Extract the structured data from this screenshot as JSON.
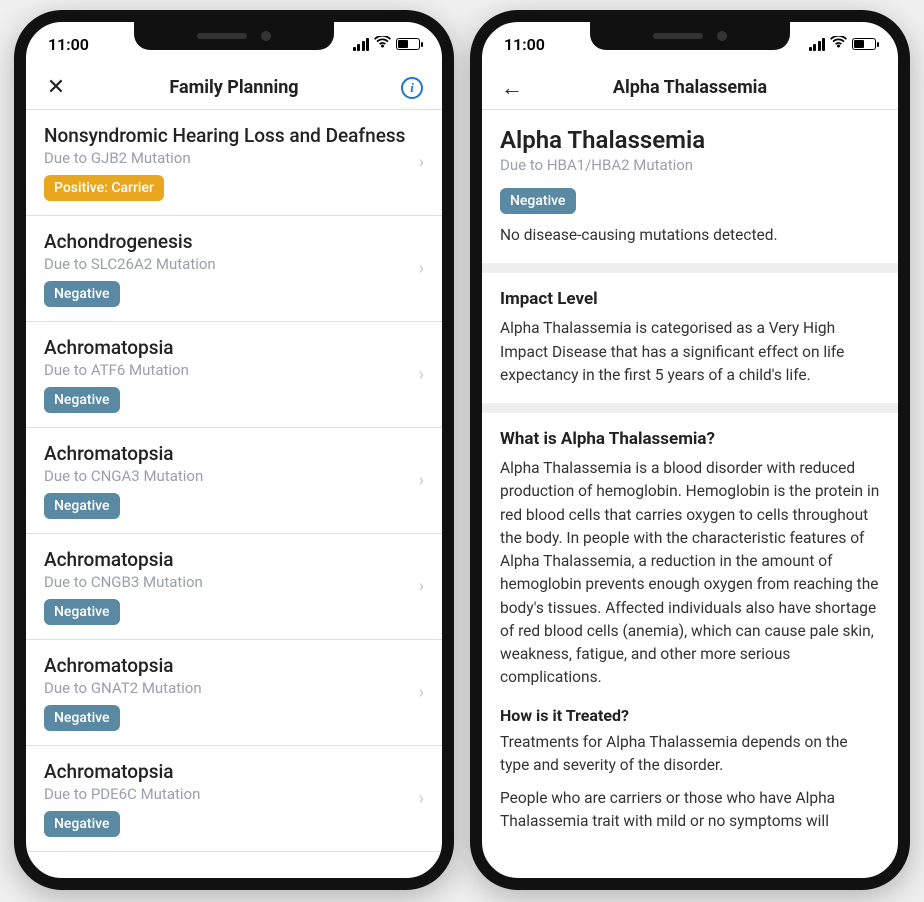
{
  "status_time": "11:00",
  "left": {
    "title": "Family Planning",
    "items": [
      {
        "title": "Nonsyndromic Hearing Loss and Deafness",
        "sub": "Due to GJB2 Mutation",
        "badge": "Positive: Carrier",
        "badge_type": "positive"
      },
      {
        "title": "Achondrogenesis",
        "sub": "Due to SLC26A2 Mutation",
        "badge": "Negative",
        "badge_type": "negative"
      },
      {
        "title": "Achromatopsia",
        "sub": "Due to ATF6 Mutation",
        "badge": "Negative",
        "badge_type": "negative"
      },
      {
        "title": "Achromatopsia",
        "sub": "Due to CNGA3 Mutation",
        "badge": "Negative",
        "badge_type": "negative"
      },
      {
        "title": "Achromatopsia",
        "sub": "Due to CNGB3 Mutation",
        "badge": "Negative",
        "badge_type": "negative"
      },
      {
        "title": "Achromatopsia",
        "sub": "Due to GNAT2 Mutation",
        "badge": "Negative",
        "badge_type": "negative"
      },
      {
        "title": "Achromatopsia",
        "sub": "Due to PDE6C Mutation",
        "badge": "Negative",
        "badge_type": "negative"
      }
    ]
  },
  "right": {
    "title": "Alpha Thalassemia",
    "detail_title": "Alpha Thalassemia",
    "detail_sub": "Due to HBA1/HBA2 Mutation",
    "badge": "Negative",
    "result_text": "No disease-causing mutations detected.",
    "impact_heading": "Impact Level",
    "impact_text": "Alpha Thalassemia is categorised as a Very High Impact Disease that has a significant effect on life expectancy in the first 5 years of a child's life.",
    "what_heading": "What is Alpha Thalassemia?",
    "what_text": "Alpha Thalassemia is a blood disorder with reduced production of hemoglobin. Hemoglobin is the protein in red blood cells that carries oxygen to cells throughout the body. In people with the characteristic features of Alpha Thalassemia, a reduction in the amount of hemoglobin prevents enough oxygen from reaching the body's tissues. Affected individuals also have shortage of red blood cells (anemia), which can cause pale skin, weakness, fatigue, and other more serious complications.",
    "treated_heading": "How is it Treated?",
    "treated_text1": "Treatments for Alpha Thalassemia depends on the type and severity of the disorder.",
    "treated_text2": "People who are carriers or those who have Alpha Thalassemia trait with mild or no symptoms will"
  }
}
